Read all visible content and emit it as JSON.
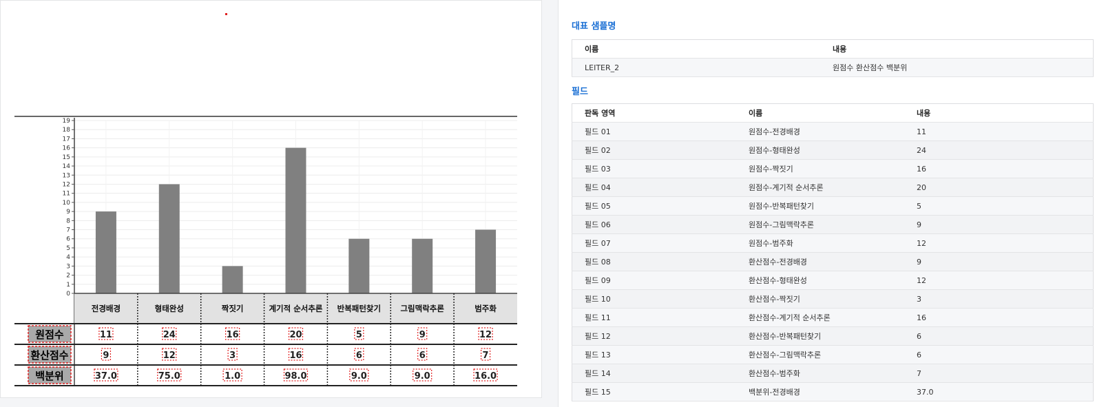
{
  "left_panel": {
    "chart_data": {
      "type": "bar",
      "categories": [
        "전경배경",
        "형태완성",
        "짝짓기",
        "계기적 순서추론",
        "반복패턴찾기",
        "그림맥락추론",
        "범주화"
      ],
      "values": [
        9,
        12,
        3,
        16,
        6,
        6,
        7
      ],
      "ylim": [
        0,
        19
      ],
      "yticks": [
        "0",
        "1",
        "2",
        "3",
        "4",
        "5",
        "6",
        "7",
        "8",
        "9",
        "10",
        "11",
        "12",
        "13",
        "14",
        "15",
        "16",
        "17",
        "18",
        "19"
      ],
      "grid": true,
      "colors": {
        "bar": "#808080",
        "header_bg": "#e2e2e2",
        "highlight": "#e02020"
      }
    },
    "score_table": {
      "rows": [
        {
          "label": "원점수",
          "values": [
            "11",
            "24",
            "16",
            "20",
            "5",
            "9",
            "12"
          ]
        },
        {
          "label": "환산점수",
          "values": [
            "9",
            "12",
            "3",
            "16",
            "6",
            "6",
            "7"
          ]
        },
        {
          "label": "백분위",
          "values": [
            "37.0",
            "75.0",
            "1.0",
            "98.0",
            "9.0",
            "9.0",
            "16.0"
          ]
        }
      ]
    }
  },
  "right_panel": {
    "sample_section": {
      "title": "대표 샘플명",
      "columns": [
        "이름",
        "내용"
      ],
      "rows": [
        [
          "LEITER_2",
          "원점수 환산점수 백분위"
        ]
      ]
    },
    "field_section": {
      "title": "필드",
      "columns": [
        "판독 영역",
        "이름",
        "내용"
      ],
      "rows": [
        [
          "필드 01",
          "원점수-전경배경",
          "11"
        ],
        [
          "필드 02",
          "원점수-형태완성",
          "24"
        ],
        [
          "필드 03",
          "원점수-짝짓기",
          "16"
        ],
        [
          "필드 04",
          "원점수-계기적 순서추론",
          "20"
        ],
        [
          "필드 05",
          "원점수-반복패턴찾기",
          "5"
        ],
        [
          "필드 06",
          "원점수-그림맥락추론",
          "9"
        ],
        [
          "필드 07",
          "원점수-범주화",
          "12"
        ],
        [
          "필드 08",
          "환산점수-전경배경",
          "9"
        ],
        [
          "필드 09",
          "환산점수-형태완성",
          "12"
        ],
        [
          "필드 10",
          "환산점수-짝짓기",
          "3"
        ],
        [
          "필드 11",
          "환산점수-계기적 순서추론",
          "16"
        ],
        [
          "필드 12",
          "환산점수-반복패턴찾기",
          "6"
        ],
        [
          "필드 13",
          "환산점수-그림맥락추론",
          "6"
        ],
        [
          "필드 14",
          "환산점수-범주화",
          "7"
        ],
        [
          "필드 15",
          "백분위-전경배경",
          "37.0"
        ]
      ]
    }
  }
}
